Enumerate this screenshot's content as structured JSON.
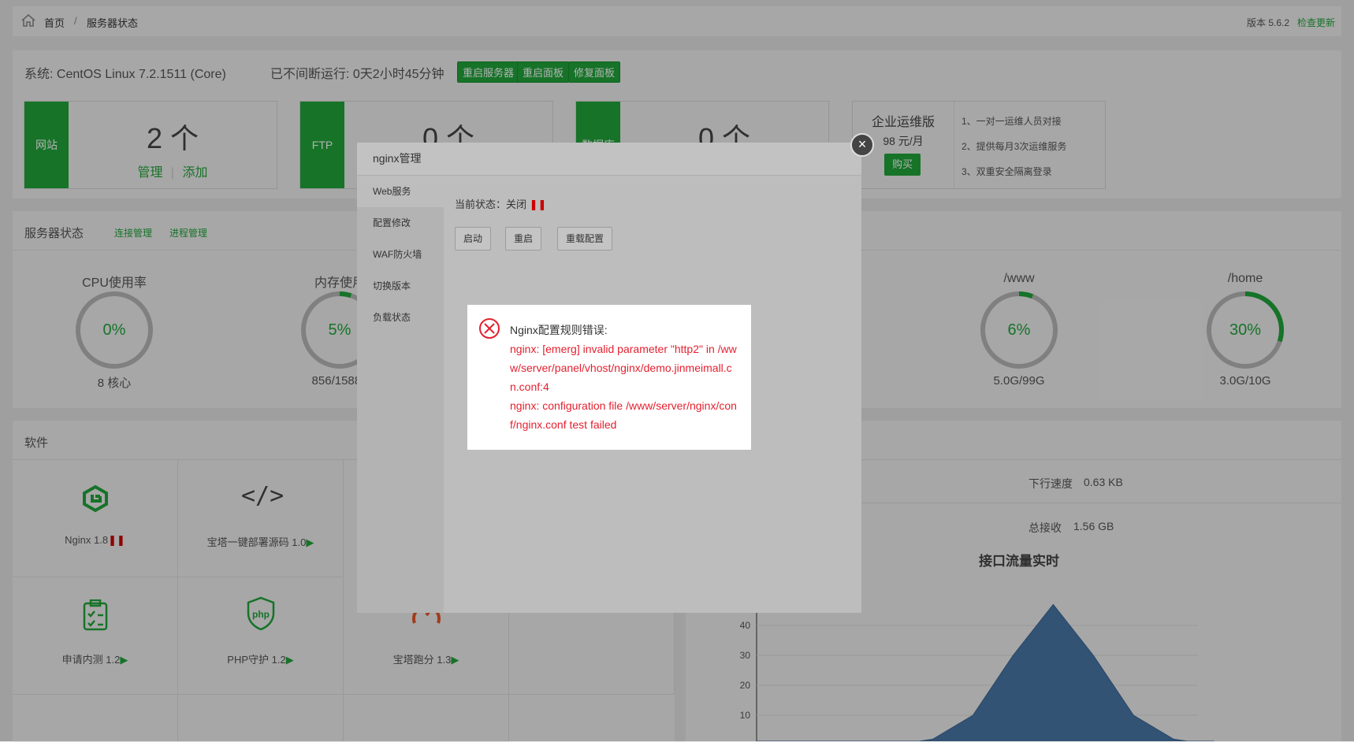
{
  "breadcrumb": {
    "home": "首页",
    "sep": "/",
    "current": "服务器状态"
  },
  "version": {
    "label": "版本 5.6.2",
    "update": "检查更新"
  },
  "system": {
    "os": "系统: CentOS Linux 7.2.1511 (Core)",
    "uptime": "已不间断运行: 0天2小时45分钟",
    "buttons": [
      "重启服务器",
      "重启面板",
      "修复面板"
    ]
  },
  "cards": [
    {
      "label": "网站",
      "value": "2 个",
      "link1": "管理",
      "sep": "|",
      "link2": "添加"
    },
    {
      "label": "FTP",
      "value": "0 个"
    },
    {
      "label": "数据库",
      "value": "0 个"
    }
  ],
  "enterprise": {
    "title": "企业运维版",
    "price": "98 元/月",
    "buy": "购买",
    "features": [
      "1、一对一运维人员对接",
      "2、提供每月3次运维服务",
      "3、双重安全隔离登录"
    ]
  },
  "server_status": {
    "title": "服务器状态",
    "link1": "连接管理",
    "link2": "进程管理"
  },
  "gauges": [
    {
      "title": "CPU使用率",
      "value": "0%",
      "percent": 0,
      "sub": "8 核心"
    },
    {
      "title": "内存使用",
      "value": "5%",
      "percent": 5,
      "sub": "856/15886"
    },
    {
      "title": "/www",
      "value": "6%",
      "percent": 6,
      "sub": "5.0G/99G"
    },
    {
      "title": "/home",
      "value": "30%",
      "percent": 30,
      "sub": "3.0G/10G"
    }
  ],
  "software": {
    "title": "软件",
    "items": [
      {
        "name": "Nginx 1.8",
        "icon": "nginx-icon"
      },
      {
        "name": "宝塔一键部署源码 1.0",
        "icon": "code-icon"
      },
      {
        "name": "申请内测 1.2",
        "icon": "clipboard-icon"
      },
      {
        "name": "PHP守护 1.2",
        "icon": "php-shield-icon"
      },
      {
        "name": "宝塔跑分 1.3",
        "icon": "speed-icon"
      }
    ]
  },
  "traffic": {
    "down_label": "下行速度",
    "down_value": "0.63 KB",
    "total_label": "总接收",
    "total_value": "1.56 GB",
    "chart_title": "接口流量实时"
  },
  "chart_data": {
    "type": "area",
    "title": "接口流量实时",
    "y_ticks": [
      40,
      30,
      20,
      10
    ],
    "series": [
      {
        "values": [
          0,
          0,
          0,
          0,
          2,
          10,
          30,
          47,
          30,
          10,
          2,
          0
        ]
      }
    ]
  },
  "modal": {
    "title": "nginx管理",
    "menu": [
      "Web服务",
      "配置修改",
      "WAF防火墙",
      "切换版本",
      "负载状态"
    ],
    "status_label": "当前状态：关闭",
    "buttons": [
      "启动",
      "重启",
      "重载配置"
    ]
  },
  "error": {
    "title": "Nginx配置规则错误:",
    "line1": "nginx: [emerg] invalid parameter \"http2\" in /www/server/panel/vhost/nginx/demo.jinmeimall.cn.conf:4",
    "line2": "nginx: configuration file /www/server/nginx/conf/nginx.conf test failed"
  },
  "colors": {
    "accent": "#20a53a",
    "error": "#e4202f"
  }
}
